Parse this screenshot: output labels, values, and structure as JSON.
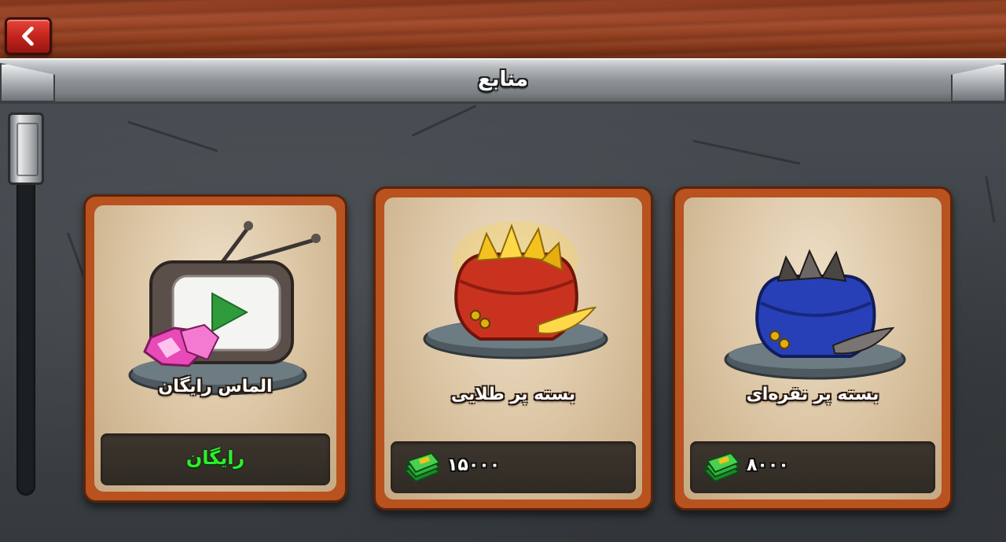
{
  "header": {
    "title": "منابع",
    "back_icon": "chevron-left-icon"
  },
  "colors": {
    "wood": "#9b4424",
    "back_button": "#d0281f",
    "free_text": "#2bf02b",
    "card_frame": "#b8521f"
  },
  "shop": {
    "items": [
      {
        "name": "الماس رایگان",
        "price_text": "رایگان",
        "icon": "tv-gem-icon",
        "currency_icon": ""
      },
      {
        "name": "بسته پر طلایی",
        "price_text": "۱۵۰۰۰",
        "icon": "gold-feather-bag-icon",
        "currency_icon": "cash-icon"
      },
      {
        "name": "بسته پر نقره‌ای",
        "price_text": "۸۰۰۰",
        "icon": "silver-feather-bag-icon",
        "currency_icon": "cash-icon"
      }
    ]
  }
}
